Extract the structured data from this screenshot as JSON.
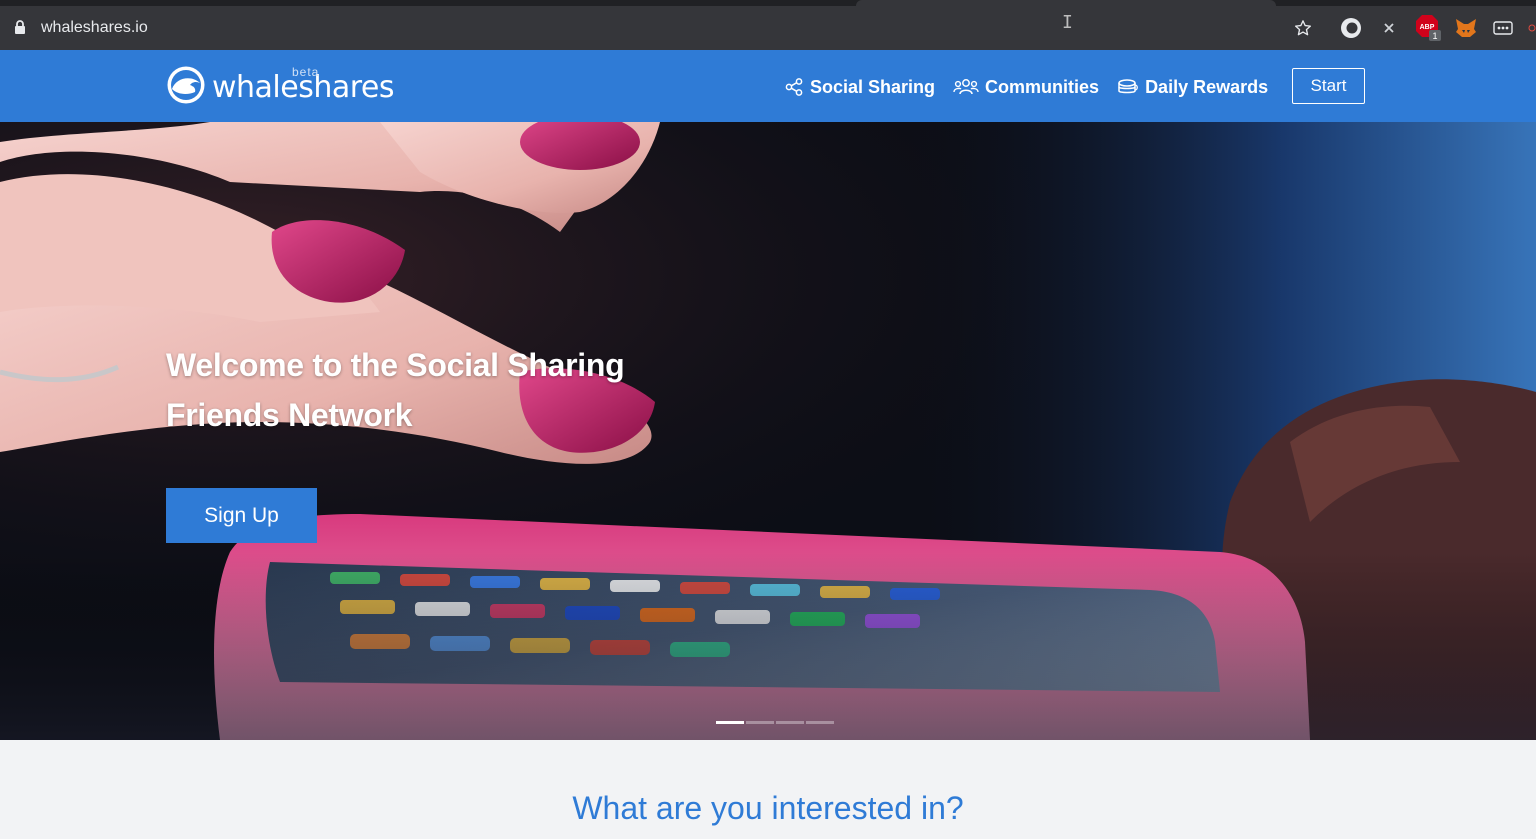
{
  "browser": {
    "url": "whaleshares.io",
    "extensions": [
      "bookmark-star-icon",
      "circle-extension-icon",
      "x-extension-icon",
      "adblock-icon",
      "metamask-fox-icon",
      "more-icon"
    ],
    "adblock_badge": "1",
    "adblock_label": "ABP"
  },
  "site": {
    "logo_text": "whaleshares",
    "logo_badge": "beta",
    "nav": [
      {
        "label": "Social Sharing",
        "icon": "share-nodes-icon"
      },
      {
        "label": "Communities",
        "icon": "users-icon"
      },
      {
        "label": "Daily Rewards",
        "icon": "coins-icon"
      }
    ],
    "start_label": "Start",
    "brand_color": "#2f7bd6"
  },
  "hero": {
    "title_line1": "Welcome to the Social Sharing",
    "title_line2": "Friends Network",
    "signup_label": "Sign Up",
    "slides": 4,
    "active_slide": 1
  },
  "section": {
    "heading": "What are you interested in?"
  }
}
